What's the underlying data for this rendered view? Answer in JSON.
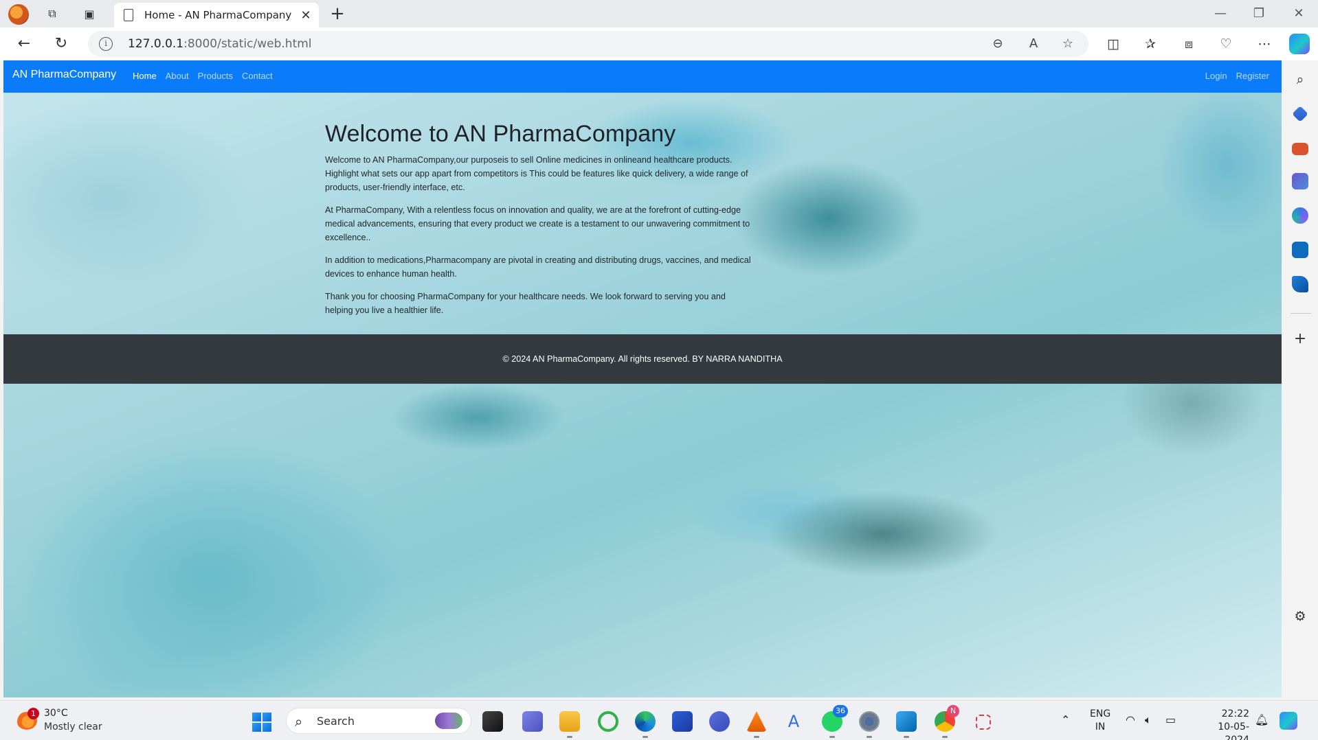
{
  "browser": {
    "tab_title": "Home - AN PharmaCompany",
    "new_tab": "+",
    "close_tab": "✕",
    "url_host": "127.0.0.1",
    "url_rest": ":8000/static/web.html",
    "window_controls": {
      "minimize": "—",
      "restore": "❐",
      "close": "✕"
    }
  },
  "site": {
    "brand": "AN PharmaCompany",
    "nav": [
      "Home",
      "About",
      "Products",
      "Contact"
    ],
    "auth": [
      "Login",
      "Register"
    ],
    "heading": "Welcome to AN PharmaCompany",
    "paragraphs": [
      "Welcome to AN PharmaCompany,our purposeis to sell Online medicines in onlineand healthcare products. Highlight what sets our app apart from competitors is This could be features like quick delivery, a wide range of products, user-friendly interface, etc.",
      "At PharmaCompany, With a relentless focus on innovation and quality, we are at the forefront of cutting-edge medical advancements, ensuring that every product we create is a testament to our unwavering commitment to excellence..",
      "In addition to medications,Pharmacompany are pivotal in creating and distributing drugs, vaccines, and medical devices to enhance human health.",
      "Thank you for choosing PharmaCompany for your healthcare needs. We look forward to serving you and helping you live a healthier life."
    ],
    "footer": "© 2024 AN PharmaCompany. All rights reserved. BY NARRA NANDITHA",
    "colors": {
      "navbar": "#0a7cfa",
      "footer": "#343a40"
    }
  },
  "taskbar": {
    "weather_temp": "30°C",
    "weather_desc": "Mostly clear",
    "weather_badge": "1",
    "search_label": "Search",
    "whatsapp_badge": "36",
    "chrome_badge": "N",
    "lang_1": "ENG",
    "lang_2": "IN",
    "time": "22:22",
    "date": "10-05-2024"
  }
}
